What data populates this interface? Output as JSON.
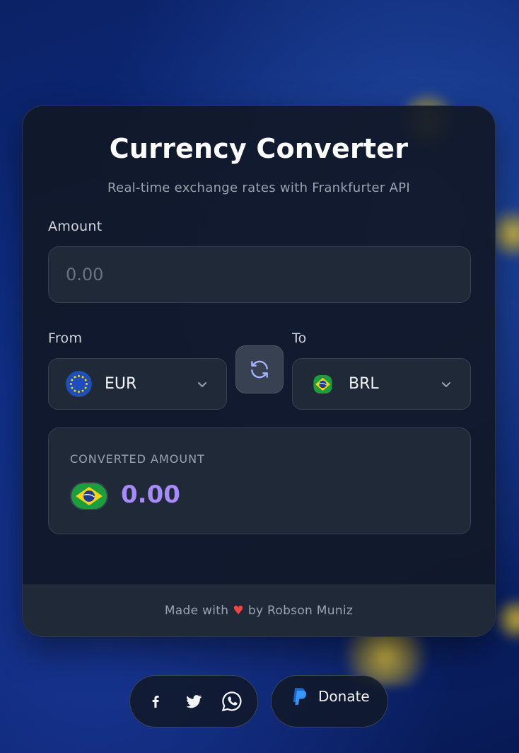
{
  "header": {
    "title": "Currency Converter",
    "subtitle": "Real-time exchange rates with Frankfurter API"
  },
  "amount": {
    "label": "Amount",
    "value": "",
    "placeholder": "0.00"
  },
  "from": {
    "label": "From",
    "currency": "EUR",
    "flag_icon": "eu-flag-icon"
  },
  "swap": {
    "icon": "swap-refresh-icon"
  },
  "to": {
    "label": "To",
    "currency": "BRL",
    "flag_icon": "brazil-flag-icon"
  },
  "result": {
    "label": "CONVERTED AMOUNT",
    "value": "0.00",
    "flag_icon": "brazil-flag-icon"
  },
  "footer": {
    "prefix": "Made with",
    "heart": "♥",
    "suffix": "by Robson Muniz"
  },
  "social": {
    "icons": [
      "facebook-icon",
      "twitter-icon",
      "whatsapp-icon"
    ]
  },
  "donate": {
    "label": "Donate",
    "icon": "paypal-icon"
  },
  "colors": {
    "accent": "#a78bfa",
    "heart": "#ef4444",
    "card_bg": "#111827",
    "field_bg": "#1f2937"
  }
}
